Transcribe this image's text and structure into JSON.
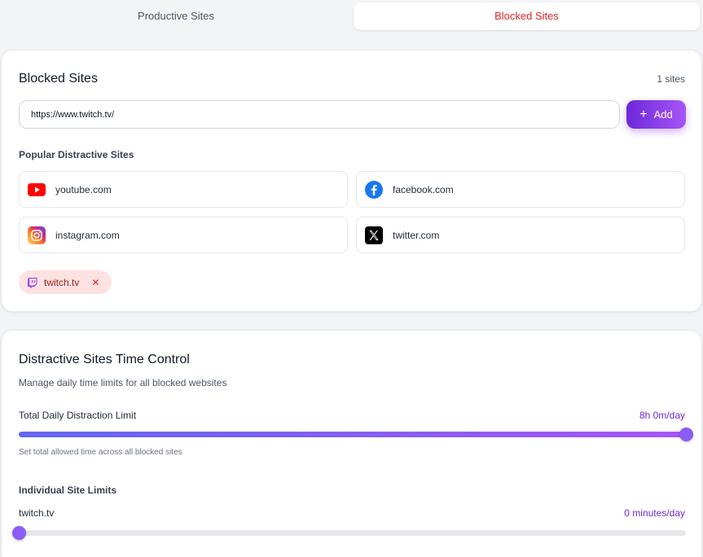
{
  "tabs": {
    "productive_label": "Productive Sites",
    "blocked_label": "Blocked Sites"
  },
  "blocked_card": {
    "title": "Blocked Sites",
    "count_text": "1 sites",
    "input_value": "https://www.twitch.tv/",
    "add_label": "Add",
    "popular_label": "Popular Distractive Sites",
    "popular_sites": [
      {
        "name": "youtube.com",
        "icon": "youtube-icon"
      },
      {
        "name": "facebook.com",
        "icon": "facebook-icon"
      },
      {
        "name": "instagram.com",
        "icon": "instagram-icon"
      },
      {
        "name": "twitter.com",
        "icon": "x-twitter-icon"
      }
    ],
    "blocked_chips": [
      {
        "label": "twitch.tv",
        "icon": "twitch-icon",
        "close": "✕"
      }
    ]
  },
  "time_card": {
    "title": "Distractive Sites Time Control",
    "description": "Manage daily time limits for all blocked websites",
    "total_label": "Total Daily Distraction Limit",
    "total_value": "8h 0m/day",
    "total_fraction": 1.0,
    "total_hint": "Set total allowed time across all blocked sites",
    "individual_label": "Individual Site Limits",
    "sites": [
      {
        "name": "twitch.tv",
        "value": "0 minutes/day",
        "fraction": 0.0
      }
    ]
  },
  "colors": {
    "accent": "#7c3aed",
    "blocked_tab_text": "#dc2626",
    "chip_bg": "#fee2e2"
  }
}
